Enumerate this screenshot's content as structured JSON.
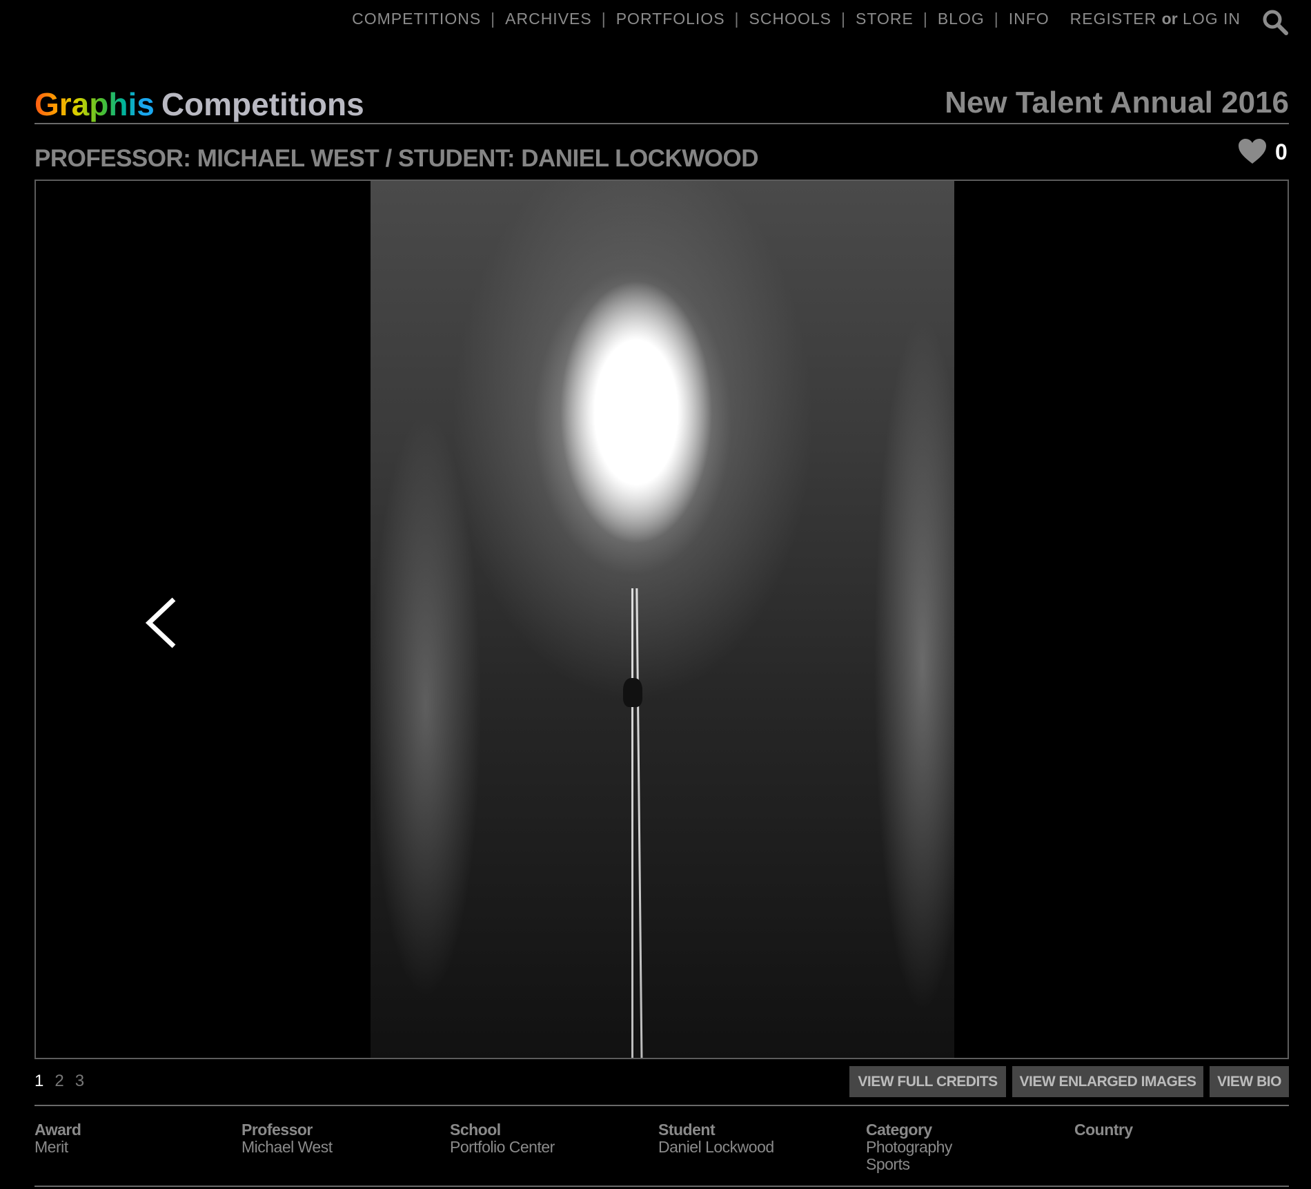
{
  "nav": {
    "items": [
      "COMPETITIONS",
      "ARCHIVES",
      "PORTFOLIOS",
      "SCHOOLS",
      "STORE",
      "BLOG",
      "INFO"
    ],
    "register": "REGISTER",
    "or": "or",
    "login": "LOG IN"
  },
  "logo": {
    "brand": "Graphis",
    "section": "Competitions"
  },
  "annual": "New Talent Annual 2016",
  "entry_title": "PROFESSOR: MICHAEL WEST / STUDENT: DANIEL LOCKWOOD",
  "likes": "0",
  "pagination": [
    "1",
    "2",
    "3"
  ],
  "buttons": {
    "credits": "VIEW FULL CREDITS",
    "enlarged": "VIEW ENLARGED IMAGES",
    "bio": "VIEW BIO"
  },
  "info": [
    {
      "label": "Award",
      "values": [
        "Merit"
      ]
    },
    {
      "label": "Professor",
      "values": [
        "Michael West"
      ]
    },
    {
      "label": "School",
      "values": [
        "Portfolio Center"
      ]
    },
    {
      "label": "Student",
      "values": [
        "Daniel Lockwood"
      ]
    },
    {
      "label": "Category",
      "values": [
        "Photography",
        "Sports"
      ]
    },
    {
      "label": "Country",
      "values": []
    }
  ]
}
